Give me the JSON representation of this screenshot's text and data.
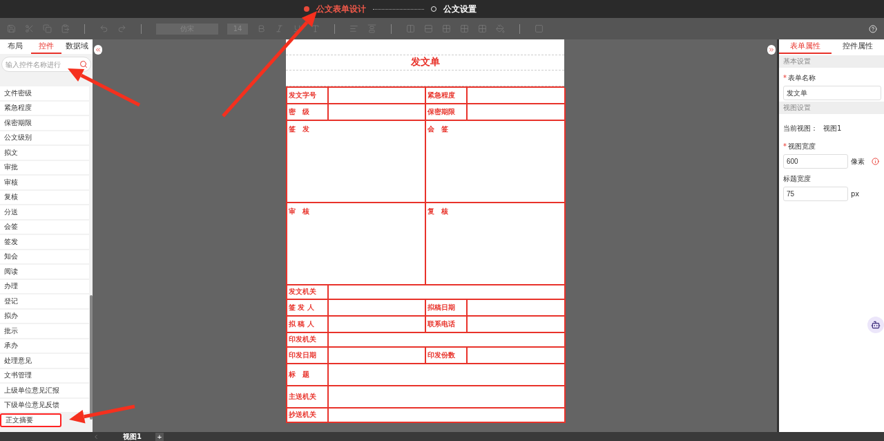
{
  "steps": [
    {
      "label": "公文表单设计",
      "selected": true
    },
    {
      "label": "公文设置",
      "selected": false
    }
  ],
  "toolbar": {
    "font": "仿宋",
    "size": "14"
  },
  "left_panel": {
    "tabs": [
      {
        "label": "布局",
        "selected": false
      },
      {
        "label": "控件",
        "selected": true
      },
      {
        "label": "数据域",
        "selected": false
      }
    ],
    "search": {
      "placeholder": "输入控件名称进行"
    },
    "items": [
      {
        "label": "文件密级",
        "highlighted": false
      },
      {
        "label": "紧急程度",
        "highlighted": false
      },
      {
        "label": "保密期限",
        "highlighted": false
      },
      {
        "label": "公文级别",
        "highlighted": false
      },
      {
        "label": "拟文",
        "highlighted": false
      },
      {
        "label": "审批",
        "highlighted": false
      },
      {
        "label": "审核",
        "highlighted": false
      },
      {
        "label": "复核",
        "highlighted": false
      },
      {
        "label": "分送",
        "highlighted": false
      },
      {
        "label": "会签",
        "highlighted": false
      },
      {
        "label": "签发",
        "highlighted": false
      },
      {
        "label": "知会",
        "highlighted": false
      },
      {
        "label": "阅读",
        "highlighted": false
      },
      {
        "label": "办理",
        "highlighted": false
      },
      {
        "label": "登记",
        "highlighted": false
      },
      {
        "label": "拟办",
        "highlighted": false
      },
      {
        "label": "批示",
        "highlighted": false
      },
      {
        "label": "承办",
        "highlighted": false
      },
      {
        "label": "处理意见",
        "highlighted": false
      },
      {
        "label": "文书管理",
        "highlighted": false
      },
      {
        "label": "上级单位意见汇报",
        "highlighted": false
      },
      {
        "label": "下级单位意见反馈",
        "highlighted": false
      },
      {
        "label": "正文摘要",
        "highlighted": true
      }
    ]
  },
  "form": {
    "title": "发文单",
    "rows": [
      {
        "kind": "pair",
        "labels": [
          "发文字号",
          "紧急程度"
        ]
      },
      {
        "kind": "pair",
        "labels": [
          "密　级",
          "保密期限"
        ]
      },
      {
        "kind": "sign",
        "labels": [
          "签　发",
          "会　签"
        ]
      },
      {
        "kind": "sign",
        "labels": [
          "审　核",
          "复　核"
        ]
      },
      {
        "kind": "wide",
        "labels": [
          "发文机关"
        ]
      },
      {
        "kind": "pair",
        "labels": [
          "签 发 人",
          "拟稿日期"
        ]
      },
      {
        "kind": "pair",
        "labels": [
          "拟 稿 人",
          "联系电话"
        ]
      },
      {
        "kind": "wide",
        "labels": [
          "印发机关"
        ]
      },
      {
        "kind": "pair",
        "labels": [
          "印发日期",
          "印发份数"
        ]
      },
      {
        "kind": "tall",
        "labels": [
          "标　题"
        ]
      },
      {
        "kind": "tall",
        "labels": [
          "主送机关"
        ]
      },
      {
        "kind": "wide",
        "labels": [
          "抄送机关"
        ]
      }
    ]
  },
  "right_panel": {
    "tabs": [
      {
        "label": "表单属性",
        "selected": true
      },
      {
        "label": "控件属性",
        "selected": false
      }
    ],
    "sections": [
      {
        "title": "基本设置",
        "fields": [
          {
            "kind": "input",
            "label": "表单名称",
            "required_mark": "*",
            "value": "发文单"
          }
        ]
      },
      {
        "title": "视图设置",
        "fields": [
          {
            "kind": "text",
            "label": "当前视图：",
            "value": "视图1"
          },
          {
            "kind": "input",
            "label": "视图宽度",
            "required_mark": "*",
            "value": "600",
            "unit": "像素",
            "info": true
          },
          {
            "kind": "input",
            "label": "标题宽度",
            "value": "75",
            "unit": "px",
            "info": false
          }
        ]
      }
    ]
  },
  "view_tabs": [
    {
      "label": "视图1",
      "selected": true
    }
  ],
  "add_view": "+"
}
